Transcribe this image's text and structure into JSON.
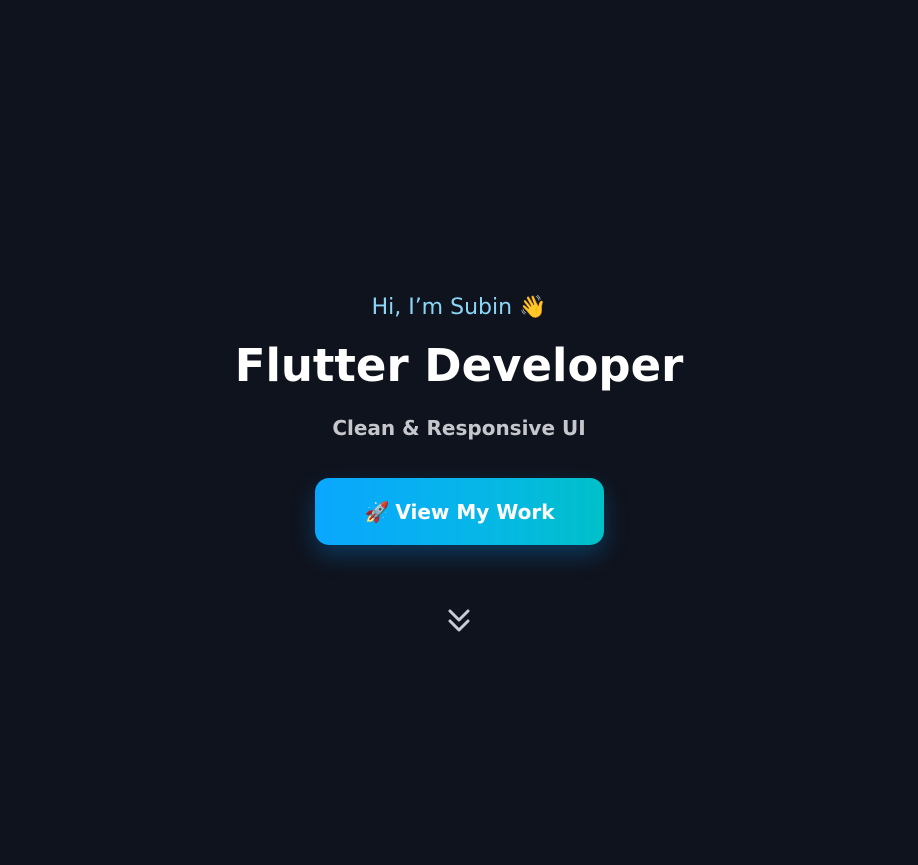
{
  "hero": {
    "greeting": "Hi, I’m Subin 👋",
    "title": "Flutter Developer",
    "subtitle": "Clean & Responsive UI",
    "cta": {
      "icon": "🚀",
      "label": "View My Work"
    },
    "scroll_icon": "double-chevron-down-icon"
  },
  "colors": {
    "background": "#0f131d",
    "greeting": "#8bd6f7",
    "title": "#ffffff",
    "subtitle": "#c5c7cc",
    "button_gradient_start": "#0aa7ff",
    "button_gradient_end": "#00c0c9",
    "scroll_icon": "#c8ccd6"
  }
}
